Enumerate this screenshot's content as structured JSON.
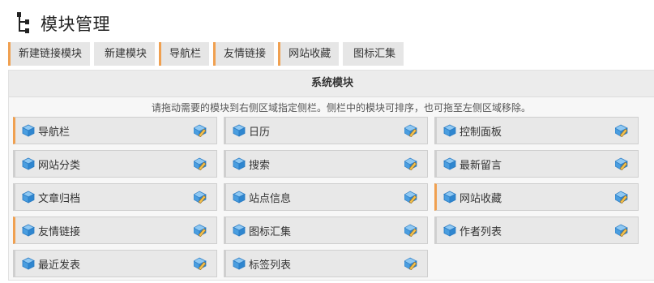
{
  "page": {
    "title": "模块管理"
  },
  "tabs": [
    {
      "label": "新建链接模块",
      "accent": true
    },
    {
      "label": "新建模块",
      "accent": false
    },
    {
      "label": "导航栏",
      "accent": true
    },
    {
      "label": "友情链接",
      "accent": true
    },
    {
      "label": "网站收藏",
      "accent": true
    },
    {
      "label": "图标汇集",
      "accent": false
    }
  ],
  "panel": {
    "title": "系统模块",
    "hint": "请拖动需要的模块到右侧区域指定侧栏。侧栏中的模块可排序，也可拖至左侧区域移除。"
  },
  "modules": [
    {
      "label": "导航栏",
      "accent": true
    },
    {
      "label": "日历",
      "accent": false
    },
    {
      "label": "控制面板",
      "accent": false
    },
    {
      "label": "网站分类",
      "accent": false
    },
    {
      "label": "搜索",
      "accent": false
    },
    {
      "label": "最新留言",
      "accent": false
    },
    {
      "label": "文章归档",
      "accent": false
    },
    {
      "label": "站点信息",
      "accent": false
    },
    {
      "label": "网站收藏",
      "accent": true
    },
    {
      "label": "友情链接",
      "accent": true
    },
    {
      "label": "图标汇集",
      "accent": false
    },
    {
      "label": "作者列表",
      "accent": false
    },
    {
      "label": "最近发表",
      "accent": false
    },
    {
      "label": "标签列表",
      "accent": false
    }
  ],
  "icons": {
    "title": "sitemap-icon",
    "module": "cube-icon",
    "edit": "edit-icon"
  },
  "colors": {
    "accent": "#f0a050",
    "cube": "#3a8fd6",
    "tab_bg": "#e6e6e6"
  }
}
